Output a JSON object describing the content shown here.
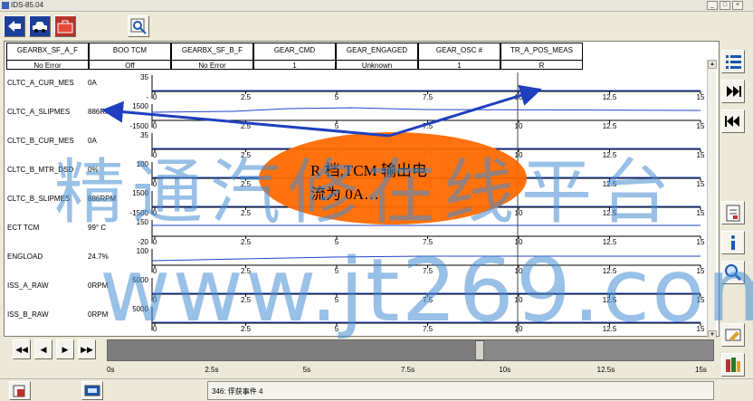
{
  "window": {
    "title": "IDS-85.04"
  },
  "pids": [
    {
      "name": "GEARBX_SF_A_F",
      "value": "No Error"
    },
    {
      "name": "BOO TCM",
      "value": "Off"
    },
    {
      "name": "GEARBX_SF_B_F",
      "value": "No Error"
    },
    {
      "name": "GEAR_CMD",
      "value": "1"
    },
    {
      "name": "GEAR_ENGAGED",
      "value": "Unknown"
    },
    {
      "name": "GEAR_OSC #",
      "value": "1"
    },
    {
      "name": "TR_A_POS_MEAS",
      "value": "R"
    }
  ],
  "signals": [
    {
      "label": "CLTC_A_CUR_MES",
      "value": "0A",
      "ymax": "35",
      "ymin": "-"
    },
    {
      "label": "CLTC_A_SLIPMES",
      "value": "886RPM",
      "ymax": "1500",
      "ymin": "-1500"
    },
    {
      "label": "CLTC_B_CUR_MES",
      "value": "0A",
      "ymax": "35",
      "ymin": ""
    },
    {
      "label": "CLTC_B_MTR_DSD",
      "value": "0%",
      "ymax": "100",
      "ymin": ""
    },
    {
      "label": "CLTC_B_SLIPMES",
      "value": "886RPM",
      "ymax": "1500",
      "ymin": "-1500"
    },
    {
      "label": "ECT TCM",
      "value": "99° C",
      "ymax": "150",
      "ymin": "-20"
    },
    {
      "label": "ENGLOAD",
      "value": "24.7%",
      "ymax": "100",
      "ymin": ""
    },
    {
      "label": "ISS_A_RAW",
      "value": "0RPM",
      "ymax": "5000",
      "ymin": ""
    },
    {
      "label": "ISS_B_RAW",
      "value": "0RPM",
      "ymax": "5000",
      "ymin": ""
    }
  ],
  "time_ticks": [
    "0",
    "2.5",
    "5",
    "7.5",
    "10",
    "12.5",
    "15"
  ],
  "timeline": {
    "ticks": [
      "0s",
      "2.5s",
      "5s",
      "7.5s",
      "10s",
      "12.5s",
      "15s"
    ],
    "position_fraction": 0.615
  },
  "playback": {
    "rewind_label": "◀◀",
    "back_label": "◀",
    "forward_label": "▶",
    "fastforward_label": "▶▶"
  },
  "status": {
    "text": "346: 俘获事件 4"
  },
  "annotation": {
    "text": "R 档,TCM 输出电\n流为 0A…"
  },
  "watermark": {
    "chinese": "精通汽修在线平台",
    "url": "www.jt269.com"
  },
  "colors": {
    "trace": "#2244cc",
    "arrow": "#1f3fbf",
    "annotation": "#ff6a00",
    "cursor": "#444444"
  }
}
